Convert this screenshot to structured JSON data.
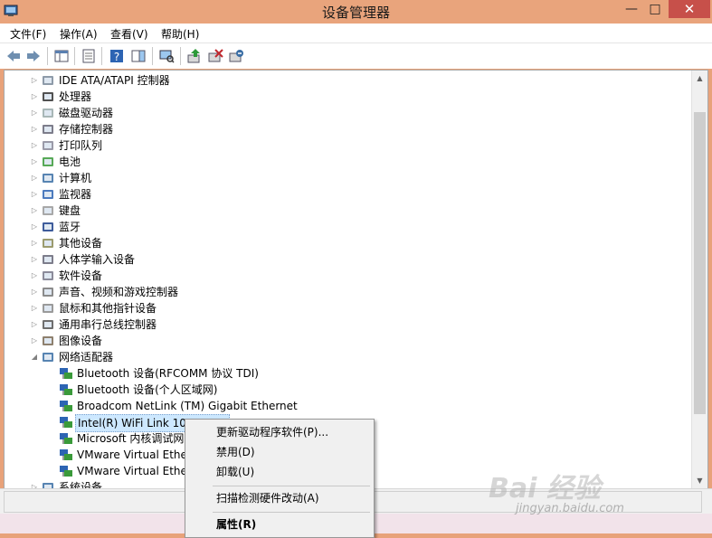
{
  "window": {
    "title": "设备管理器",
    "min_label": "—",
    "max_label": "□",
    "close_label": "✕"
  },
  "menu": [
    "文件(F)",
    "操作(A)",
    "查看(V)",
    "帮助(H)"
  ],
  "tree": {
    "categories": [
      {
        "label": "IDE ATA/ATAPI 控制器",
        "icon": "ide-controller-icon"
      },
      {
        "label": "处理器",
        "icon": "processor-icon"
      },
      {
        "label": "磁盘驱动器",
        "icon": "disk-drive-icon"
      },
      {
        "label": "存储控制器",
        "icon": "storage-controller-icon"
      },
      {
        "label": "打印队列",
        "icon": "printer-icon"
      },
      {
        "label": "电池",
        "icon": "battery-icon"
      },
      {
        "label": "计算机",
        "icon": "computer-icon"
      },
      {
        "label": "监视器",
        "icon": "monitor-icon"
      },
      {
        "label": "键盘",
        "icon": "keyboard-icon"
      },
      {
        "label": "蓝牙",
        "icon": "bluetooth-icon"
      },
      {
        "label": "其他设备",
        "icon": "other-devices-icon"
      },
      {
        "label": "人体学输入设备",
        "icon": "hid-icon"
      },
      {
        "label": "软件设备",
        "icon": "software-device-icon"
      },
      {
        "label": "声音、视频和游戏控制器",
        "icon": "speaker-icon"
      },
      {
        "label": "鼠标和其他指针设备",
        "icon": "mouse-icon"
      },
      {
        "label": "通用串行总线控制器",
        "icon": "usb-icon"
      },
      {
        "label": "图像设备",
        "icon": "imaging-device-icon"
      },
      {
        "label": "网络适配器",
        "icon": "network-adapter-icon"
      }
    ],
    "network_children": [
      "Bluetooth 设备(RFCOMM 协议 TDI)",
      "Bluetooth 设备(个人区域网)",
      "Broadcom NetLink (TM) Gigabit Ethernet",
      "Intel(R) WiFi Link 1000 BGN",
      "Microsoft 内核调试网",
      "VMware Virtual Ethe",
      "VMware Virtual Ethe"
    ],
    "last_category": "系统设备"
  },
  "context_menu": {
    "update_driver": "更新驱动程序软件(P)...",
    "disable": "禁用(D)",
    "uninstall": "卸载(U)",
    "scan_hardware": "扫描检测硬件改动(A)",
    "properties": "属性(R)"
  },
  "watermark": {
    "logo": "Bai 经验",
    "url": "jingyan.baidu.com"
  },
  "colors": {
    "titlebar": "#e9a47c",
    "close_button": "#c7504a",
    "selection": "#cde8ff"
  }
}
